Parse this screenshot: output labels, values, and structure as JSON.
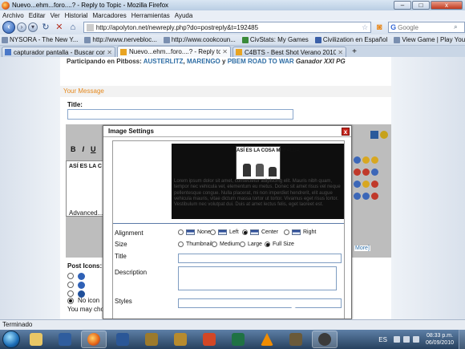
{
  "window": {
    "title": "Nuevo...ehm...foro....? - Reply to Topic - Mozilla Firefox",
    "controls": {
      "minimize": "–",
      "maximize": "□",
      "close": "x"
    }
  },
  "menu": [
    "Archivo",
    "Editar",
    "Ver",
    "Historial",
    "Marcadores",
    "Herramientas",
    "Ayuda"
  ],
  "nav": {
    "url": "http://apolyton.net/newreply.php?do=postreply&t=192485",
    "search_placeholder": "Google"
  },
  "bookmarks": [
    "NYSORA - The New Y...",
    "http://www.nervebloc...",
    "http://www.cookcoun...",
    "CivStats: My Games",
    "Civilization en Español",
    "View Game | Play Your..."
  ],
  "tabs": [
    {
      "label": "capturador pantalla - Buscar con G...",
      "active": false
    },
    {
      "label": "Nuevo...ehm...foro....? - Reply to ...",
      "active": true
    },
    {
      "label": "C4BTS - Best Shot Verano 2010: 5º R...",
      "active": false
    }
  ],
  "page": {
    "participando_prefix": "Participando en Pitboss:",
    "participando_link1": "AUSTERLITZ",
    "participando_sep1": ",",
    "participando_link2": "MARENGO",
    "participando_and": "y",
    "participando_link3": "PBEM ROAD TO WAR",
    "participando_winner": "Ganador XXI PG",
    "your_message": "Your Message",
    "title_label": "Title:",
    "editor_preview_caption": "ASÍ ES LA C",
    "advanced": "Advanced...",
    "more_link": "More]",
    "post_icons_label": "Post Icons:",
    "no_icon": "No icon",
    "may_choose": "You may choo"
  },
  "dialog": {
    "title": "Image Settings",
    "close_label": "x",
    "comic_title": "ASÍ ES LA COSA MAFALDA",
    "lorem": "Lorem ipsum dolor sit amet, consectetur adipiscing elit. Mauris nibh quam, tempor nec vehicula vel, elementum eu metus. Donec sit amet risus vel neque pellentesque congue. Nulla placerat, mi non imperdiet hendrerit, elit augue vehicula mauris, vitae dictum massa tortor ut tortor. Vivamus eget risus tortor. Vestibulum nec volutpat dui. Duis at amet lectus felis, eget laoreet est.",
    "alignment_label": "Alignment",
    "alignment_options": [
      "None",
      "Left",
      "Center",
      "Right"
    ],
    "alignment_selected": "Center",
    "size_label": "Size",
    "size_options": [
      "Thumbnail",
      "Medium",
      "Large",
      "Full Size"
    ],
    "size_selected": "Full Size",
    "title_label": "Title",
    "description_label": "Description",
    "styles_label": "Styles"
  },
  "status": "Terminado",
  "taskbar": {
    "lang": "ES",
    "time": "08:33 p.m.",
    "date": "06/09/2010"
  },
  "colors": {
    "link": "#2f6ea5",
    "your_message": "#e5891e",
    "dialog_close": "#c8261d"
  }
}
